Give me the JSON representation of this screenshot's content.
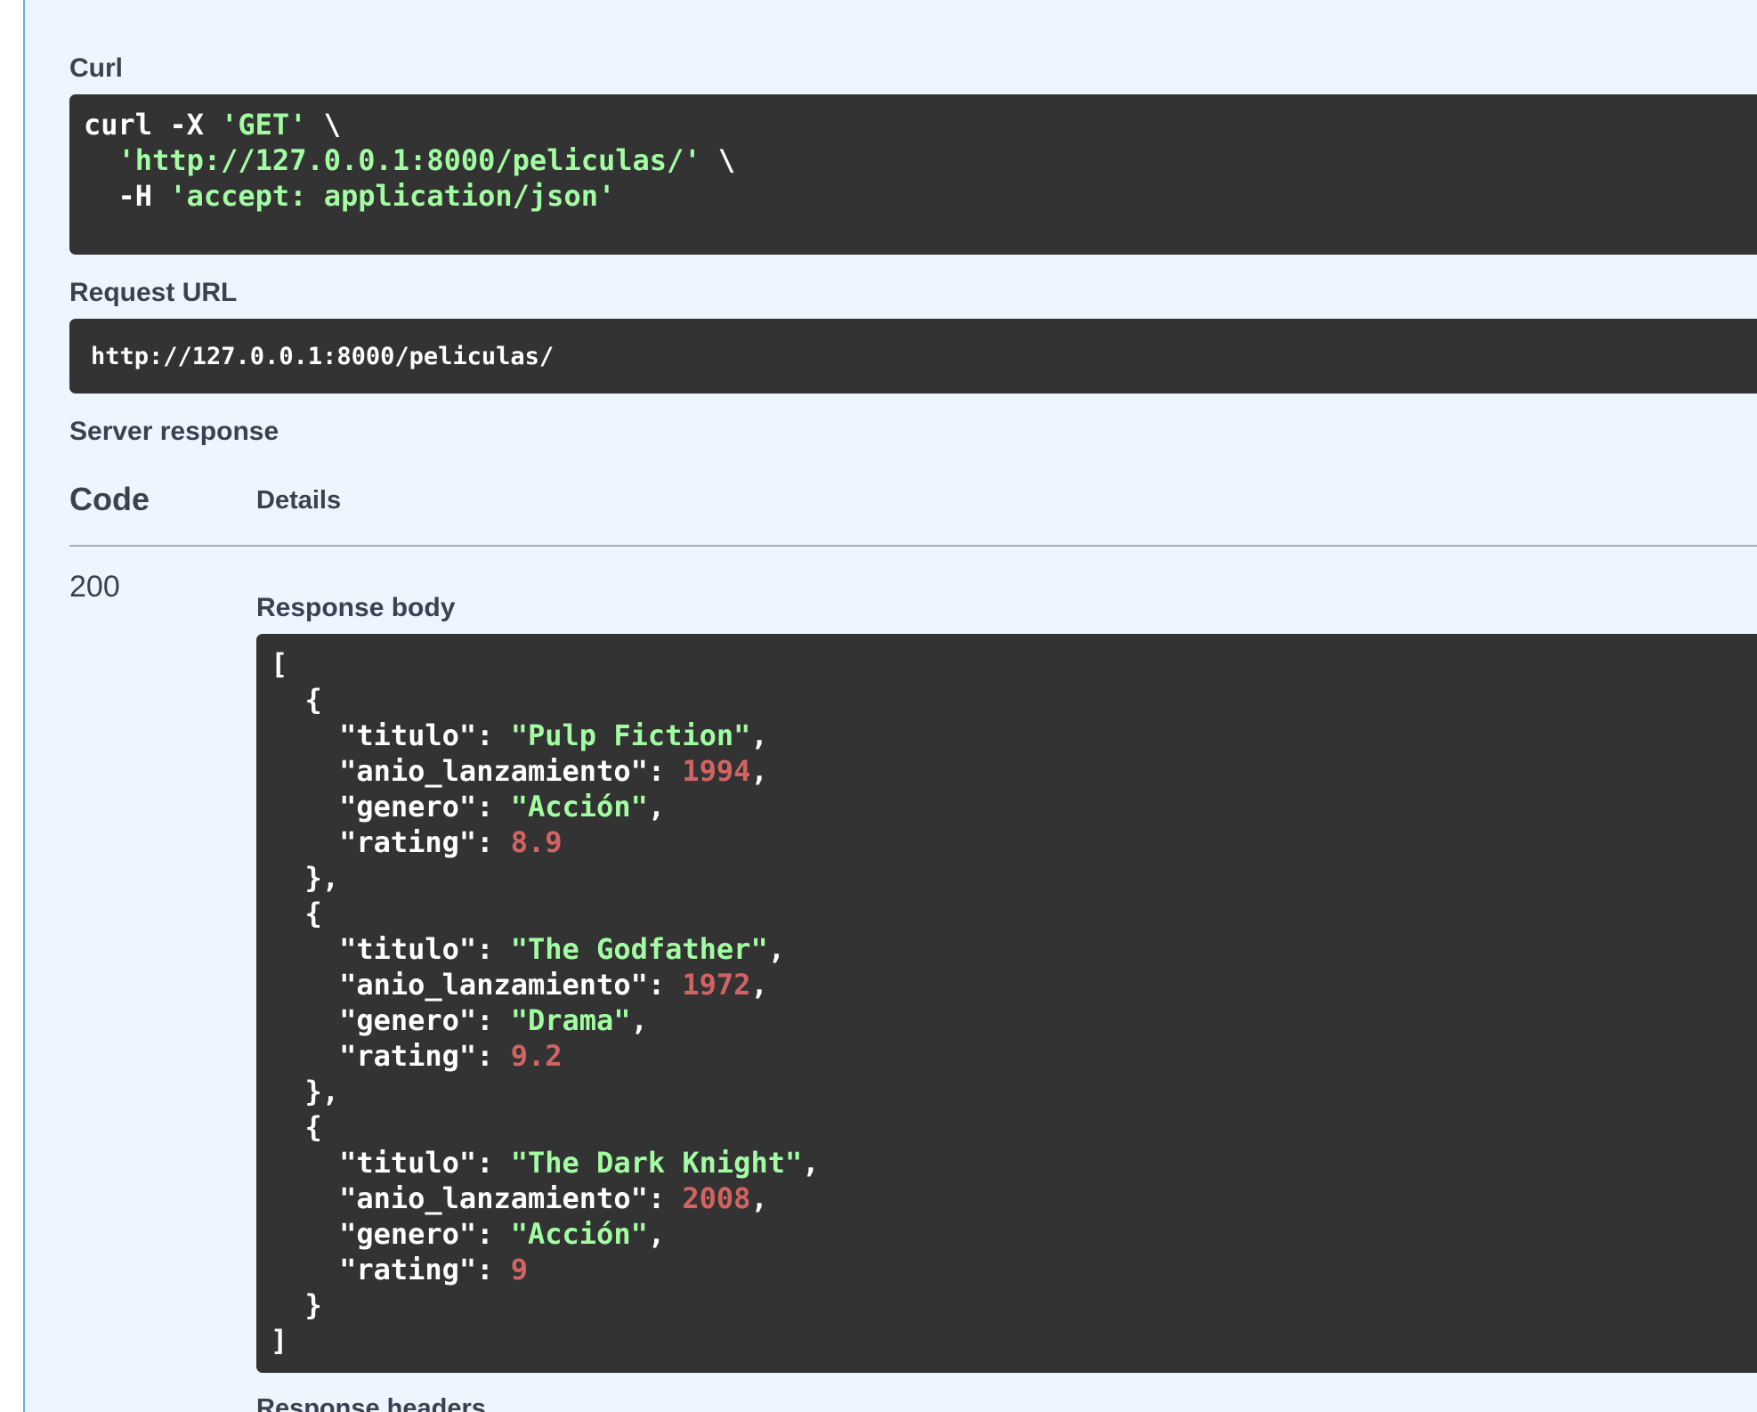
{
  "curl": {
    "label": "Curl",
    "lines": [
      [
        {
          "t": "curl -X ",
          "c": "plain"
        },
        {
          "t": "'GET'",
          "c": "str"
        },
        {
          "t": " \\",
          "c": "plain"
        }
      ],
      [
        {
          "t": "  ",
          "c": "plain"
        },
        {
          "t": "'http://127.0.0.1:8000/peliculas/'",
          "c": "str"
        },
        {
          "t": " \\",
          "c": "plain"
        }
      ],
      [
        {
          "t": "  -H ",
          "c": "plain"
        },
        {
          "t": "'accept: application/json'",
          "c": "str"
        }
      ]
    ]
  },
  "request_url": {
    "label": "Request URL",
    "value": "http://127.0.0.1:8000/peliculas/"
  },
  "server_response": {
    "label": "Server response",
    "columns": {
      "code": "Code",
      "details": "Details"
    },
    "status_code": "200",
    "response_body_label": "Response body",
    "response_headers_label": "Response headers"
  },
  "response_body": {
    "lines": [
      [
        {
          "t": "[",
          "c": "plain"
        }
      ],
      [
        {
          "t": "  {",
          "c": "plain"
        }
      ],
      [
        {
          "t": "    \"titulo\": ",
          "c": "plain"
        },
        {
          "t": "\"Pulp Fiction\"",
          "c": "str"
        },
        {
          "t": ",",
          "c": "plain"
        }
      ],
      [
        {
          "t": "    \"anio_lanzamiento\": ",
          "c": "plain"
        },
        {
          "t": "1994",
          "c": "num"
        },
        {
          "t": ",",
          "c": "plain"
        }
      ],
      [
        {
          "t": "    \"genero\": ",
          "c": "plain"
        },
        {
          "t": "\"Acción\"",
          "c": "str"
        },
        {
          "t": ",",
          "c": "plain"
        }
      ],
      [
        {
          "t": "    \"rating\": ",
          "c": "plain"
        },
        {
          "t": "8.9",
          "c": "num"
        }
      ],
      [
        {
          "t": "  },",
          "c": "plain"
        }
      ],
      [
        {
          "t": "  {",
          "c": "plain"
        }
      ],
      [
        {
          "t": "    \"titulo\": ",
          "c": "plain"
        },
        {
          "t": "\"The Godfather\"",
          "c": "str"
        },
        {
          "t": ",",
          "c": "plain"
        }
      ],
      [
        {
          "t": "    \"anio_lanzamiento\": ",
          "c": "plain"
        },
        {
          "t": "1972",
          "c": "num"
        },
        {
          "t": ",",
          "c": "plain"
        }
      ],
      [
        {
          "t": "    \"genero\": ",
          "c": "plain"
        },
        {
          "t": "\"Drama\"",
          "c": "str"
        },
        {
          "t": ",",
          "c": "plain"
        }
      ],
      [
        {
          "t": "    \"rating\": ",
          "c": "plain"
        },
        {
          "t": "9.2",
          "c": "num"
        }
      ],
      [
        {
          "t": "  },",
          "c": "plain"
        }
      ],
      [
        {
          "t": "  {",
          "c": "plain"
        }
      ],
      [
        {
          "t": "    \"titulo\": ",
          "c": "plain"
        },
        {
          "t": "\"The Dark Knight\"",
          "c": "str"
        },
        {
          "t": ",",
          "c": "plain"
        }
      ],
      [
        {
          "t": "    \"anio_lanzamiento\": ",
          "c": "plain"
        },
        {
          "t": "2008",
          "c": "num"
        },
        {
          "t": ",",
          "c": "plain"
        }
      ],
      [
        {
          "t": "    \"genero\": ",
          "c": "plain"
        },
        {
          "t": "\"Acción\"",
          "c": "str"
        },
        {
          "t": ",",
          "c": "plain"
        }
      ],
      [
        {
          "t": "    \"rating\": ",
          "c": "plain"
        },
        {
          "t": "9",
          "c": "num"
        }
      ],
      [
        {
          "t": "  }",
          "c": "plain"
        }
      ],
      [
        {
          "t": "]",
          "c": "plain"
        }
      ]
    ]
  },
  "colors": {
    "background": "#edf5fe",
    "code_background": "#333333",
    "string": "#a2fca2",
    "number": "#d36363",
    "accent_border": "#61affe"
  }
}
